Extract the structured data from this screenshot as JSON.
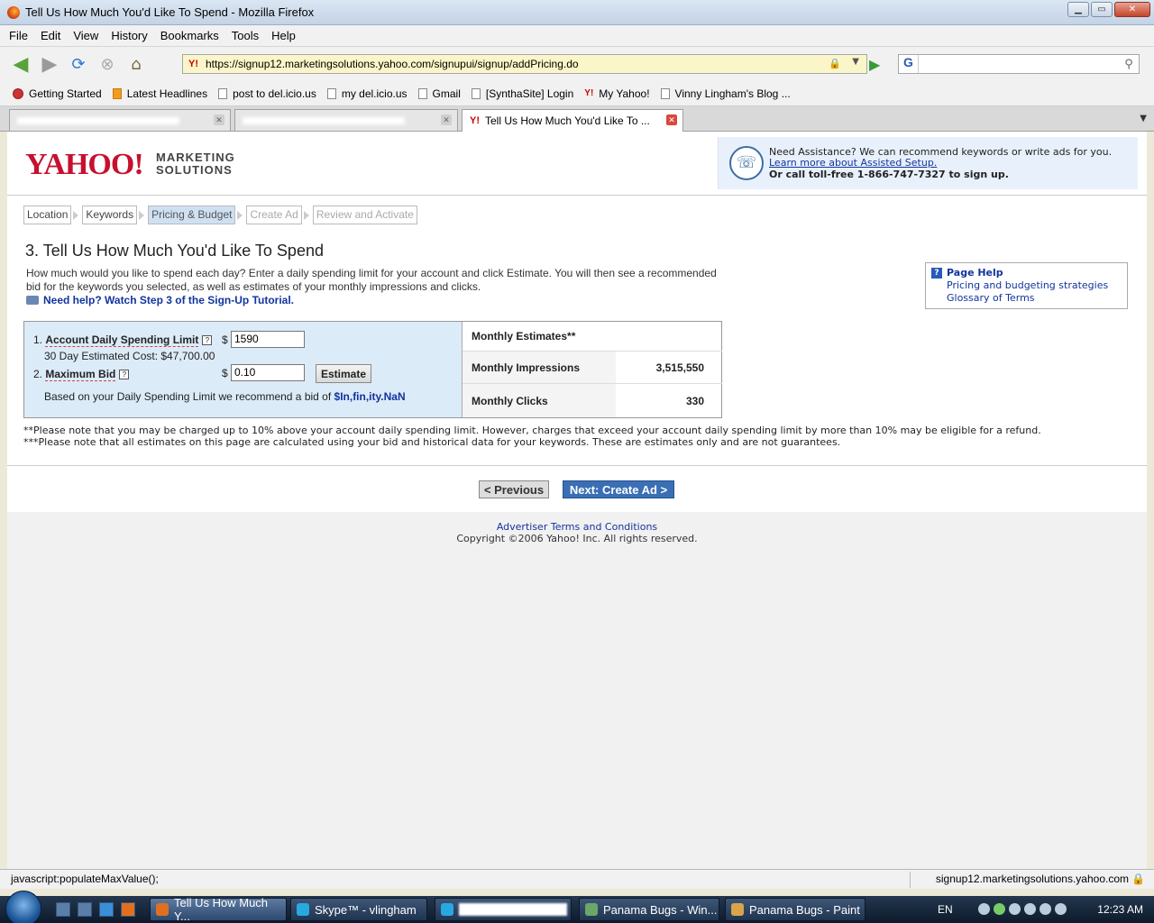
{
  "window": {
    "title": "Tell Us How Much You'd Like To Spend - Mozilla Firefox"
  },
  "menu": [
    "File",
    "Edit",
    "View",
    "History",
    "Bookmarks",
    "Tools",
    "Help"
  ],
  "address": {
    "url": "https://signup12.marketingsolutions.yahoo.com/signupui/signup/addPricing.do",
    "favicon": "Y!"
  },
  "search": {
    "engine_label": "G",
    "value": ""
  },
  "bookmarks": [
    {
      "label": "Getting Started",
      "icon": "firefox-icon"
    },
    {
      "label": "Latest Headlines",
      "icon": "rss-icon"
    },
    {
      "label": "post to del.icio.us",
      "icon": "page-icon"
    },
    {
      "label": "my del.icio.us",
      "icon": "page-icon"
    },
    {
      "label": "Gmail",
      "icon": "page-icon"
    },
    {
      "label": "[SynthaSite] Login",
      "icon": "page-icon"
    },
    {
      "label": "My Yahoo!",
      "icon": "yahoo-icon"
    },
    {
      "label": "Vinny Lingham's Blog ...",
      "icon": "page-icon"
    }
  ],
  "tabs": [
    {
      "label": "",
      "active": false
    },
    {
      "label": "",
      "active": false
    },
    {
      "label": "Tell Us How Much You'd Like To ...",
      "active": true
    }
  ],
  "page": {
    "logo": {
      "brand": "YAHOO!",
      "line1": "MARKETING",
      "line2": "SOLUTIONS"
    },
    "assist": {
      "line1": "Need Assistance? We can recommend keywords or write ads for you.",
      "link": "Learn more about Assisted Setup.",
      "line3": "Or call toll-free 1-866-747-7327 to sign up."
    },
    "steps": [
      "Location",
      "Keywords",
      "Pricing & Budget",
      "Create Ad",
      "Review and Activate"
    ],
    "title": "3. Tell Us How Much You'd Like To Spend",
    "intro_line1": "How much would you like to spend each day? Enter a daily spending limit for your account and click Estimate. You will then see a recommended",
    "intro_line2": "bid for the keywords you selected, as well as estimates of your monthly impressions and clicks.",
    "tutorial_link": "Need help? Watch Step 3 of the Sign-Up Tutorial.",
    "help": {
      "title": "Page Help",
      "link1": "Pricing and budgeting strategies",
      "link2": "Glossary of Terms"
    },
    "form": {
      "limit_num": "1.",
      "limit_label": "Account Daily Spending Limit",
      "currency": "$",
      "limit_value": "1590",
      "est_cost": "30 Day Estimated Cost: $47,700.00",
      "bid_num": "2.",
      "bid_label": "Maximum Bid",
      "bid_value": "0.10",
      "estimate_button": "Estimate",
      "recommend_text": "Based on your Daily Spending Limit we recommend a bid of",
      "recommend_value": "$In,fin,ity.NaN",
      "help_glyph": "?"
    },
    "estimates": {
      "header": "Monthly Estimates**",
      "impressions_label": "Monthly Impressions",
      "impressions_value": "3,515,550",
      "clicks_label": "Monthly Clicks",
      "clicks_value": "330"
    },
    "note1": "**Please note that you may be charged up to 10% above your account daily spending limit. However, charges that exceed your account daily spending limit by more than 10% may be eligible for a refund.",
    "note2": "***Please note that all estimates on this page are calculated using your bid and historical data for your keywords. These are estimates only and are not guarantees.",
    "prev_button": "< Previous",
    "next_button": "Next: Create Ad >",
    "footer_link": "Advertiser Terms and Conditions",
    "copyright": "Copyright ©2006 Yahoo! Inc. All rights reserved."
  },
  "status": {
    "left": "javascript:populateMaxValue();",
    "right": "signup12.marketingsolutions.yahoo.com"
  },
  "taskbar": {
    "items": [
      {
        "label": "Tell Us How Much Y...",
        "active": true
      },
      {
        "label": "Skype™ - vlingham",
        "active": false
      },
      {
        "label": "",
        "active": false
      },
      {
        "label": "Panama Bugs - Win...",
        "active": false
      },
      {
        "label": "Panama Bugs - Paint",
        "active": false
      }
    ],
    "lang": "EN",
    "clock": "12:23 AM"
  }
}
